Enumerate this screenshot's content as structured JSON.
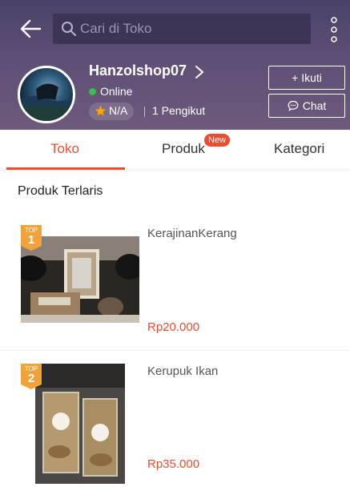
{
  "search": {
    "placeholder": "Cari di Toko"
  },
  "shop": {
    "name": "Hanzolshop07",
    "status": "Online",
    "rating": "N/A",
    "followers": "1 Pengikut",
    "follow_label": "+ Ikuti",
    "chat_label": "Chat"
  },
  "tabs": [
    {
      "label": "Toko",
      "active": true
    },
    {
      "label": "Produk",
      "badge": "New"
    },
    {
      "label": "Kategori"
    }
  ],
  "section": {
    "title": "Produk Terlaris"
  },
  "products": [
    {
      "rank_tag": "TOP",
      "rank": "1",
      "name": "KerajinanKerang",
      "price": "Rp20.000"
    },
    {
      "rank_tag": "TOP",
      "rank": "2",
      "name": "Kerupuk Ikan",
      "price": "Rp35.000"
    }
  ],
  "colors": {
    "accent": "#ee4d2d",
    "header": "#5e4f76",
    "online": "#35c24a",
    "top_badge": "#f2a23a"
  }
}
